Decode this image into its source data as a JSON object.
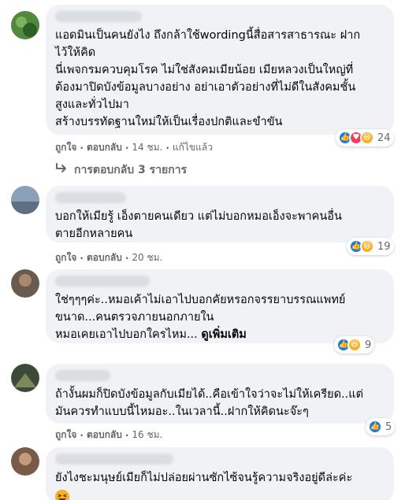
{
  "comments": [
    {
      "avatar_color": "#4f8a3d",
      "text": "แอดมินเป็นคนยังไง ถึงกล้าใช้wordingนี้สื่อสารสาธารณะ ฝาก\nไว้ให้คิด\nนี่เพจกรมควบคุมโรค ไม่ใช่สังคมเมียน้อย เมียหลวงเป็นใหญ่ที่\nต้องมาปิดบังข้อมูลบางอย่าง อย่าเอาตัวอย่างที่ไม่ดีในสังคมชั้น\nสูงและทั่วไปมา\nสร้างบรรทัดฐานใหม่ให้เป็นเรื่องปกติและขำขัน",
      "reactions": [
        "like-icon",
        "love-icon",
        "haha-icon"
      ],
      "reaction_count": "24",
      "like": "ถูกใจ",
      "reply": "ตอบกลับ",
      "time": "14 ชม.",
      "edited": "แก้ไขแล้ว"
    },
    {
      "avatar_color": "#8aa0b8",
      "text": "บอกให้เมียรู้ เอ็งตายคนเดียว แต่ไม่บอกหมอเอ็งจะพาคนอื่น\nตายอีกหลายคน",
      "reactions": [
        "like-icon",
        "haha-icon"
      ],
      "reaction_count": "19",
      "like": "ถูกใจ",
      "reply": "ตอบกลับ",
      "time": "20 ชม."
    },
    {
      "avatar_color": "#6b5a4e",
      "text_lines": [
        "ใช่ๆๆๆค่ะ..หมอเค้าไม่เอาไปบอกคัยหรอกจรรยาบรรณแพทย์",
        "ขนาด...คนตรวจภายนอกภายใน",
        "หมอเคยเอาไปบอกใครไหม..."
      ],
      "see_more": "ดูเพิ่มเติม",
      "reactions": [
        "like-icon",
        "haha-icon"
      ],
      "reaction_count": "9"
    },
    {
      "avatar_color": "#3d4a3a",
      "text": "ถ้างั้นผมก็ปิดบังข้อมูลกับเมียได้..คือเข้าใจว่าจะไม่ให้เครียด..แต่\nมันควรทำแบบนี้ไหมอะ..ในเวลานี้..ฝากให้คิดนะจ๊ะๆ",
      "reactions": [
        "like-icon"
      ],
      "reaction_count": "5",
      "like": "ถูกใจ",
      "reply": "ตอบกลับ",
      "time": "16 ชม."
    },
    {
      "avatar_color": "#7a5a48",
      "text": "ยังไงชะมนุษย์เมียก็ไม่ปล่อยผ่านซักไซ้จนรู้ความจริงอยู่ดีล่ะค่ะ",
      "emoji": "haha-icon"
    }
  ],
  "replies_link": "การตอบกลับ 3 รายการ",
  "replies_icon": "reply-arrow-icon",
  "colors": {
    "link_blue": "#1877f2",
    "muted": "#65676b",
    "bubble": "#f0f2f5"
  }
}
